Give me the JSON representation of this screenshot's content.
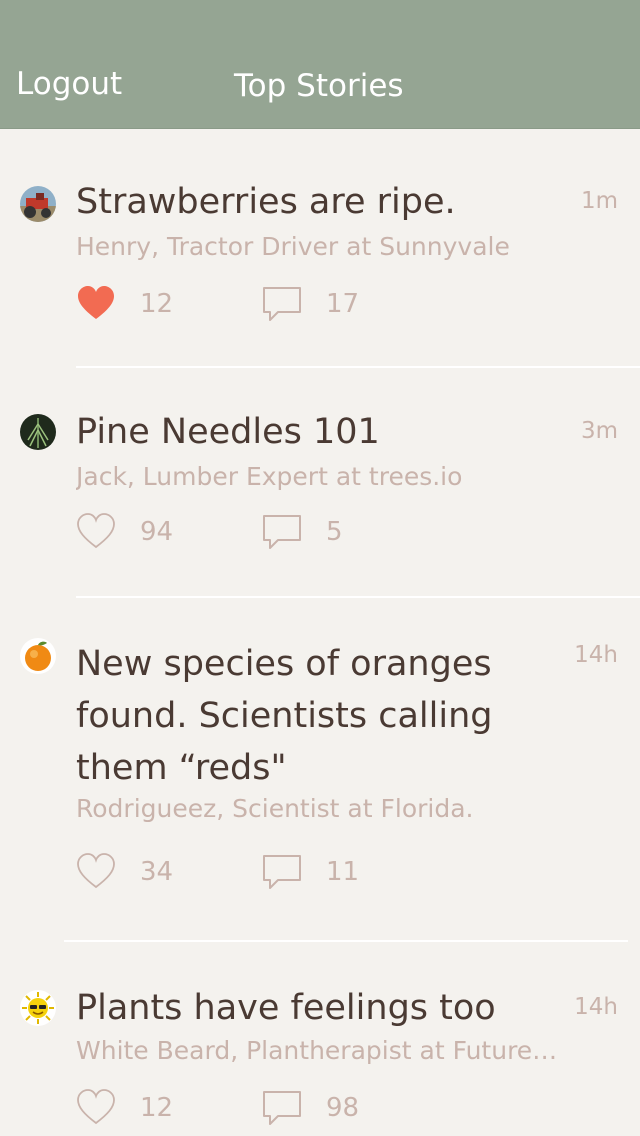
{
  "nav": {
    "logout_label": "Logout",
    "title": "Top Stories"
  },
  "colors": {
    "nav_background": "#95a593",
    "page_background": "#f4f2ee",
    "title_text": "#4a3a33",
    "meta_text": "#c9b3ab",
    "liked_heart": "#f26b52"
  },
  "stories": [
    {
      "title": "Strawberries are ripe.",
      "time": "1m",
      "author": "Henry, Tractor Driver at Sunnyvale",
      "likes": "12",
      "comments": "17",
      "liked": true,
      "avatar": "tractor-avatar"
    },
    {
      "title": "Pine Needles 101",
      "time": "3m",
      "author": "Jack, Lumber Expert at trees.io",
      "likes": "94",
      "comments": "5",
      "liked": false,
      "avatar": "pine-avatar"
    },
    {
      "title": "New species of oranges\nfound. Scientists calling\nthem “reds\"",
      "time": "14h",
      "author": "Rodrigueez, Scientist at Florida.",
      "likes": "34",
      "comments": "11",
      "liked": false,
      "avatar": "orange-avatar"
    },
    {
      "title": "Plants have feelings too",
      "time": "14h",
      "author": "White Beard, Plantherapist at Future…",
      "likes": "12",
      "comments": "98",
      "liked": false,
      "avatar": "sun-avatar"
    }
  ]
}
